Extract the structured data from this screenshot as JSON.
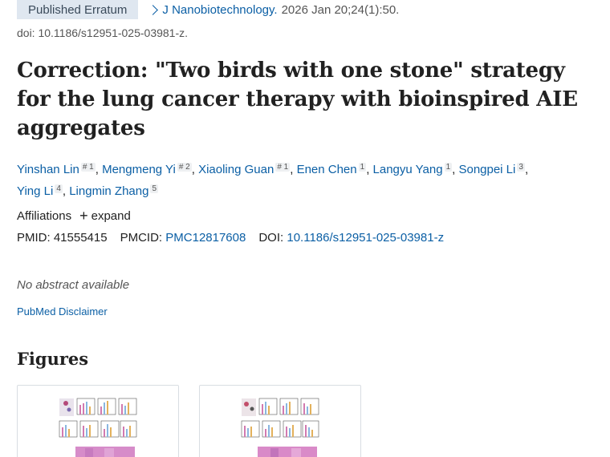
{
  "header": {
    "badge": "Published Erratum",
    "journal": "J Nanobiotechnology.",
    "citation": "2026 Jan 20;24(1):50.",
    "doi_line": "doi: 10.1186/s12951-025-03981-z."
  },
  "title": "Correction: \"Two birds with one stone\" strategy for the lung cancer therapy with bioinspired AIE aggregates",
  "authors": [
    {
      "name": "Yinshan Lin",
      "sup": "# 1"
    },
    {
      "name": "Mengmeng Yi",
      "sup": "# 2"
    },
    {
      "name": "Xiaoling Guan",
      "sup": "# 1"
    },
    {
      "name": "Enen Chen",
      "sup": "1"
    },
    {
      "name": "Langyu Yang",
      "sup": "1"
    },
    {
      "name": "Songpei Li",
      "sup": "3"
    },
    {
      "name": "Ying Li",
      "sup": "4"
    },
    {
      "name": "Lingmin Zhang",
      "sup": "5"
    }
  ],
  "affiliations": {
    "label": "Affiliations",
    "expand": "expand"
  },
  "ids": {
    "pmid_label": "PMID:",
    "pmid": "41555415",
    "pmcid_label": "PMCID:",
    "pmcid": "PMC12817608",
    "doi_label": "DOI:",
    "doi": "10.1186/s12951-025-03981-z"
  },
  "no_abstract": "No abstract available",
  "disclaimer": "PubMed Disclaimer",
  "figures_heading": "Figures",
  "colors": {
    "link": "#0b5fa5",
    "badge_bg": "#dfe7f0",
    "text": "#212121"
  }
}
